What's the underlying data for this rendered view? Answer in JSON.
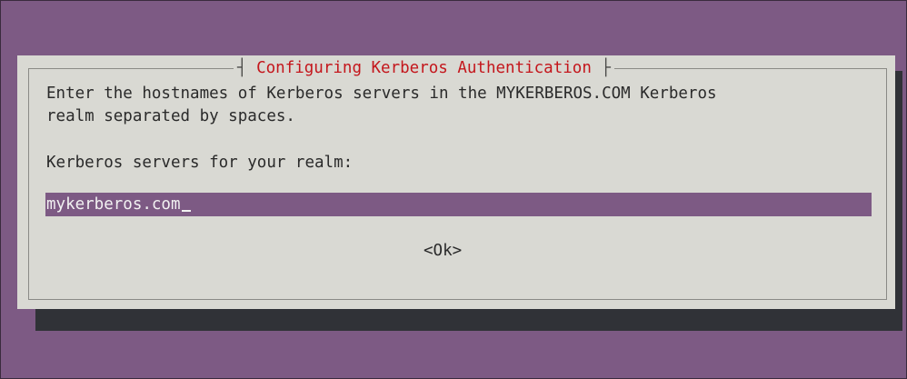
{
  "dialog": {
    "title": "Configuring Kerberos Authentication",
    "title_bar_left": "┤",
    "title_bar_right": "├",
    "description_line1": "Enter the hostnames of Kerberos servers in the MYKERBEROS.COM Kerberos",
    "description_line2": "realm separated by spaces.",
    "prompt": "Kerberos servers for your realm:",
    "input_value": "mykerberos.com",
    "ok_label": "<Ok>"
  },
  "colors": {
    "desktop_background": "#7d5a84",
    "dialog_background": "#d9d9d3",
    "dialog_shadow": "#303237",
    "title_color": "#c4161c",
    "input_background": "#7d5a84",
    "input_text": "#f2f2f2"
  }
}
